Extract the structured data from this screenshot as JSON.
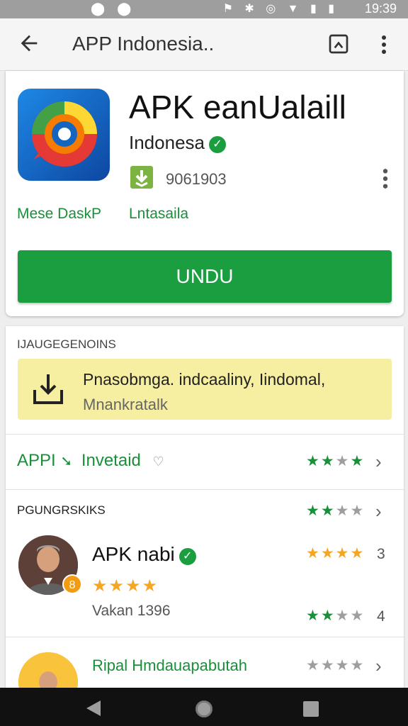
{
  "status_bar": {
    "left_icons": "⬤ ⬤",
    "mid_icons": "⚑ ✱ ◎ ▼ ▮ ▮",
    "time": "19:39"
  },
  "app_bar": {
    "title": "APP Indonesia.."
  },
  "app": {
    "name": "APK eanUalaill",
    "developer": "Indonesa",
    "downloads": "9061903",
    "link_left": "Mese DaskP",
    "link_right": "Lntasaila",
    "install_label": "UNDU"
  },
  "updates_section": {
    "heading": "IJAUGEGENOINS",
    "notice_line1": "Pnasobmga. indcaaliny, Iindomal,",
    "notice_line2": "Mnankratalk"
  },
  "rating_row": {
    "label": "APPI",
    "sublabel": "Invetaid",
    "stars": [
      "g",
      "g",
      "gr",
      "g"
    ]
  },
  "reviews": {
    "heading": "PGUNGRSKIKS",
    "header_stars": [
      "g",
      "g",
      "gr",
      "gr"
    ],
    "items": [
      {
        "name": "APK nabi",
        "badge": "8",
        "stars": "★★★★",
        "meta": "Vakan 1396",
        "right_stars_top": [
          "o",
          "o",
          "o",
          "o"
        ],
        "right_num_top": "3",
        "right_stars_bottom": [
          "g",
          "g",
          "gr",
          "gr"
        ],
        "right_num_bottom": "4"
      },
      {
        "name": "Ripal Hmdauapabutah",
        "right_stars": [
          "gr",
          "gr",
          "gr",
          "gr"
        ]
      }
    ]
  },
  "colors": {
    "accent_green": "#1a9e3f",
    "notice_bg": "#f6eea0",
    "star_orange": "#f5a623"
  }
}
